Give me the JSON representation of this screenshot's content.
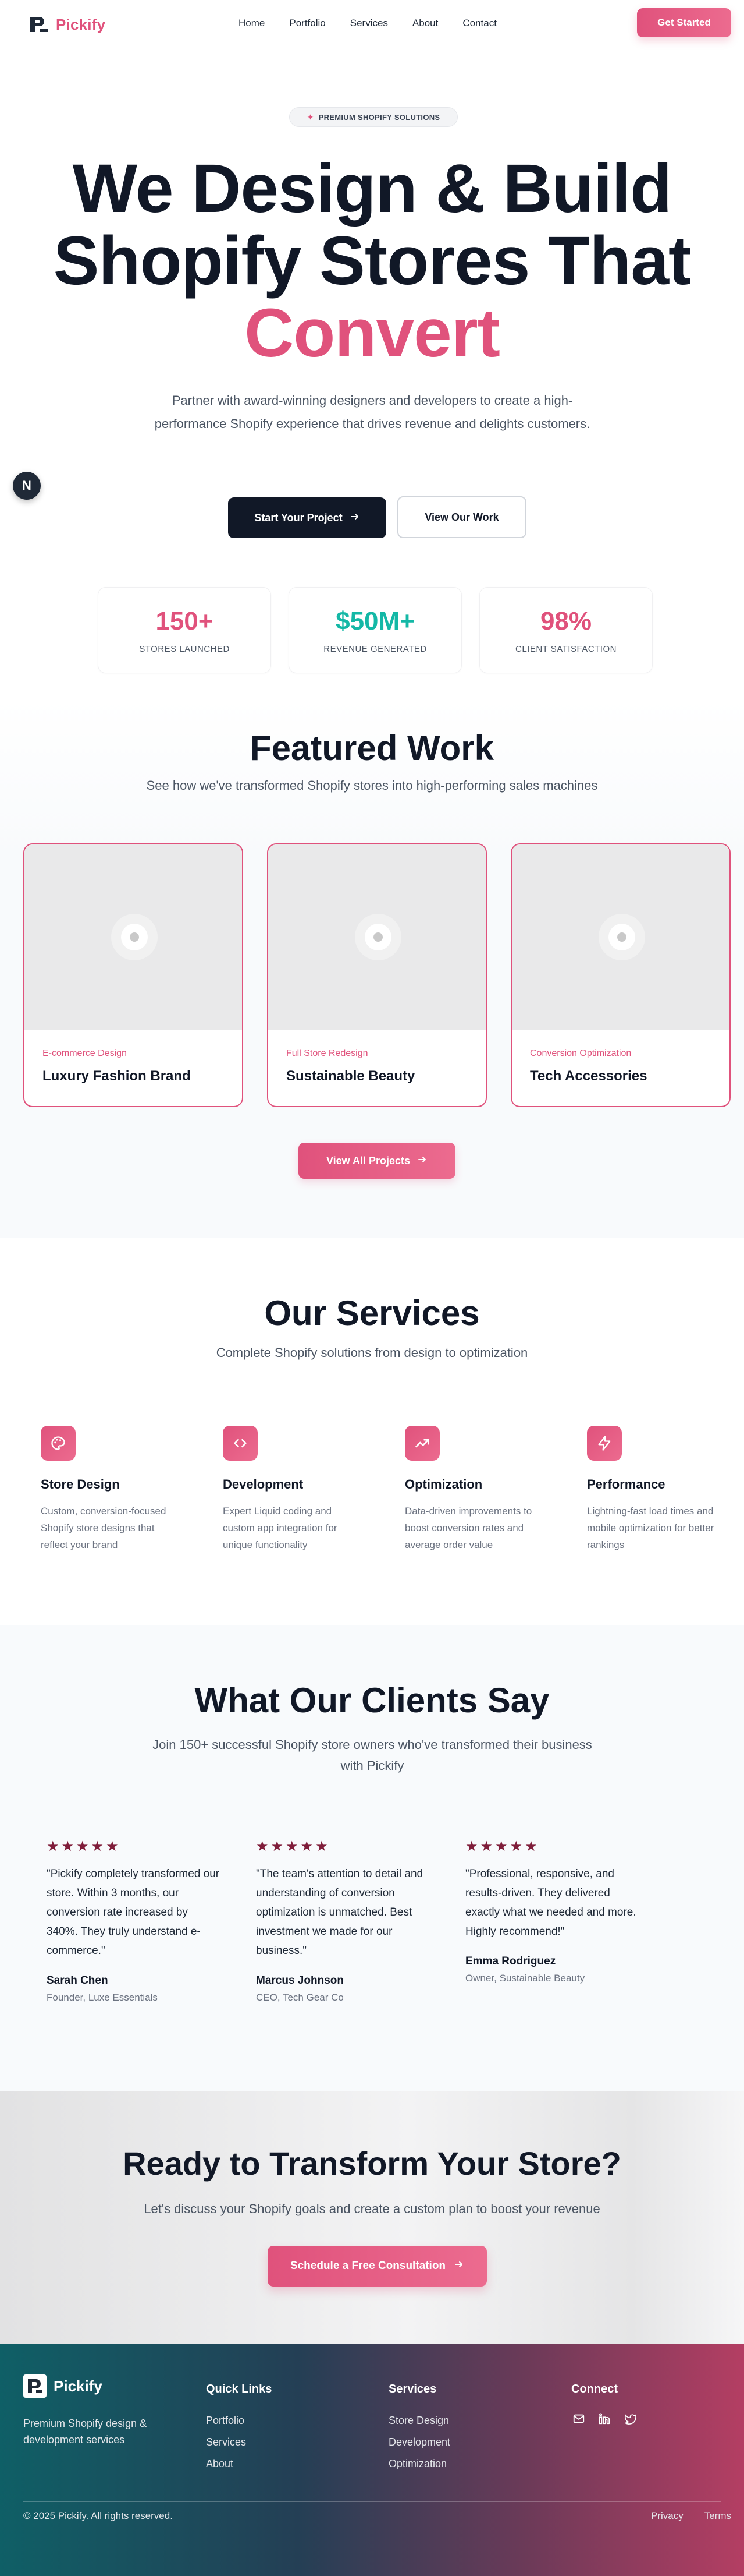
{
  "brand": {
    "name": "Pickify",
    "accent": "#e0527c",
    "dark": "#111827"
  },
  "nav": {
    "links": [
      "Home",
      "Portfolio",
      "Services",
      "About",
      "Contact"
    ],
    "cta": "Get Started"
  },
  "hero": {
    "badge": "PREMIUM SHOPIFY SOLUTIONS",
    "title_line1": "We Design & Build",
    "title_line2": "Shopify Stores That",
    "title_accent": "Convert",
    "subtitle": "Partner with award-winning designers and developers to create a high-performance Shopify experience that drives revenue and delights customers.",
    "primary_button": "Start Your Project",
    "secondary_button": "View Our Work",
    "floating_badge": "N"
  },
  "stats": [
    {
      "value": "150+",
      "label": "STORES LAUNCHED",
      "color": "#e0527c"
    },
    {
      "value": "$50M+",
      "label": "REVENUE GENERATED",
      "color": "#14b8a6"
    },
    {
      "value": "98%",
      "label": "CLIENT SATISFACTION",
      "color": "#e0527c"
    }
  ],
  "featured": {
    "title": "Featured Work",
    "subtitle": "See how we've transformed Shopify stores into high-performing sales machines",
    "projects": [
      {
        "category": "E-commerce Design",
        "name": "Luxury Fashion Brand"
      },
      {
        "category": "Full Store Redesign",
        "name": "Sustainable Beauty"
      },
      {
        "category": "Conversion Optimization",
        "name": "Tech Accessories"
      }
    ],
    "button": "View All Projects"
  },
  "services": {
    "title": "Our Services",
    "subtitle": "Complete Shopify solutions from design to optimization",
    "items": [
      {
        "icon": "palette-icon",
        "title": "Store Design",
        "desc": "Custom, conversion-focused Shopify store designs that reflect your brand"
      },
      {
        "icon": "code-icon",
        "title": "Development",
        "desc": "Expert Liquid coding and custom app integration for unique functionality"
      },
      {
        "icon": "trending-up-icon",
        "title": "Optimization",
        "desc": "Data-driven improvements to boost conversion rates and average order value"
      },
      {
        "icon": "lightning-icon",
        "title": "Performance",
        "desc": "Lightning-fast load times and mobile optimization for better rankings"
      }
    ]
  },
  "testimonials": {
    "title": "What Our Clients Say",
    "subtitle": "Join 150+ successful Shopify store owners who've transformed their business with Pickify",
    "stars": "★★★★★",
    "items": [
      {
        "quote": "\"Pickify completely transformed our store. Within 3 months, our conversion rate increased by 340%. They truly understand e-commerce.\"",
        "name": "Sarah Chen",
        "role": "Founder, Luxe Essentials"
      },
      {
        "quote": "\"The team's attention to detail and understanding of conversion optimization is unmatched. Best investment we made for our business.\"",
        "name": "Marcus Johnson",
        "role": "CEO, Tech Gear Co"
      },
      {
        "quote": "\"Professional, responsive, and results-driven. They delivered exactly what we needed and more. Highly recommend!\"",
        "name": "Emma Rodriguez",
        "role": "Owner, Sustainable Beauty"
      }
    ]
  },
  "cta": {
    "title": "Ready to Transform Your Store?",
    "subtitle": "Let's discuss your Shopify goals and create a custom plan to boost your revenue",
    "button": "Schedule a Free Consultation"
  },
  "footer": {
    "tagline": "Premium Shopify design & development services",
    "quick_links_title": "Quick Links",
    "quick_links": [
      "Portfolio",
      "Services",
      "About"
    ],
    "services_title": "Services",
    "services_links": [
      "Store Design",
      "Development",
      "Optimization"
    ],
    "connect_title": "Connect",
    "socials": [
      "mail-icon",
      "linkedin-icon",
      "twitter-icon"
    ],
    "copyright": "© 2025 Pickify. All rights reserved.",
    "legal": [
      "Privacy",
      "Terms"
    ]
  }
}
